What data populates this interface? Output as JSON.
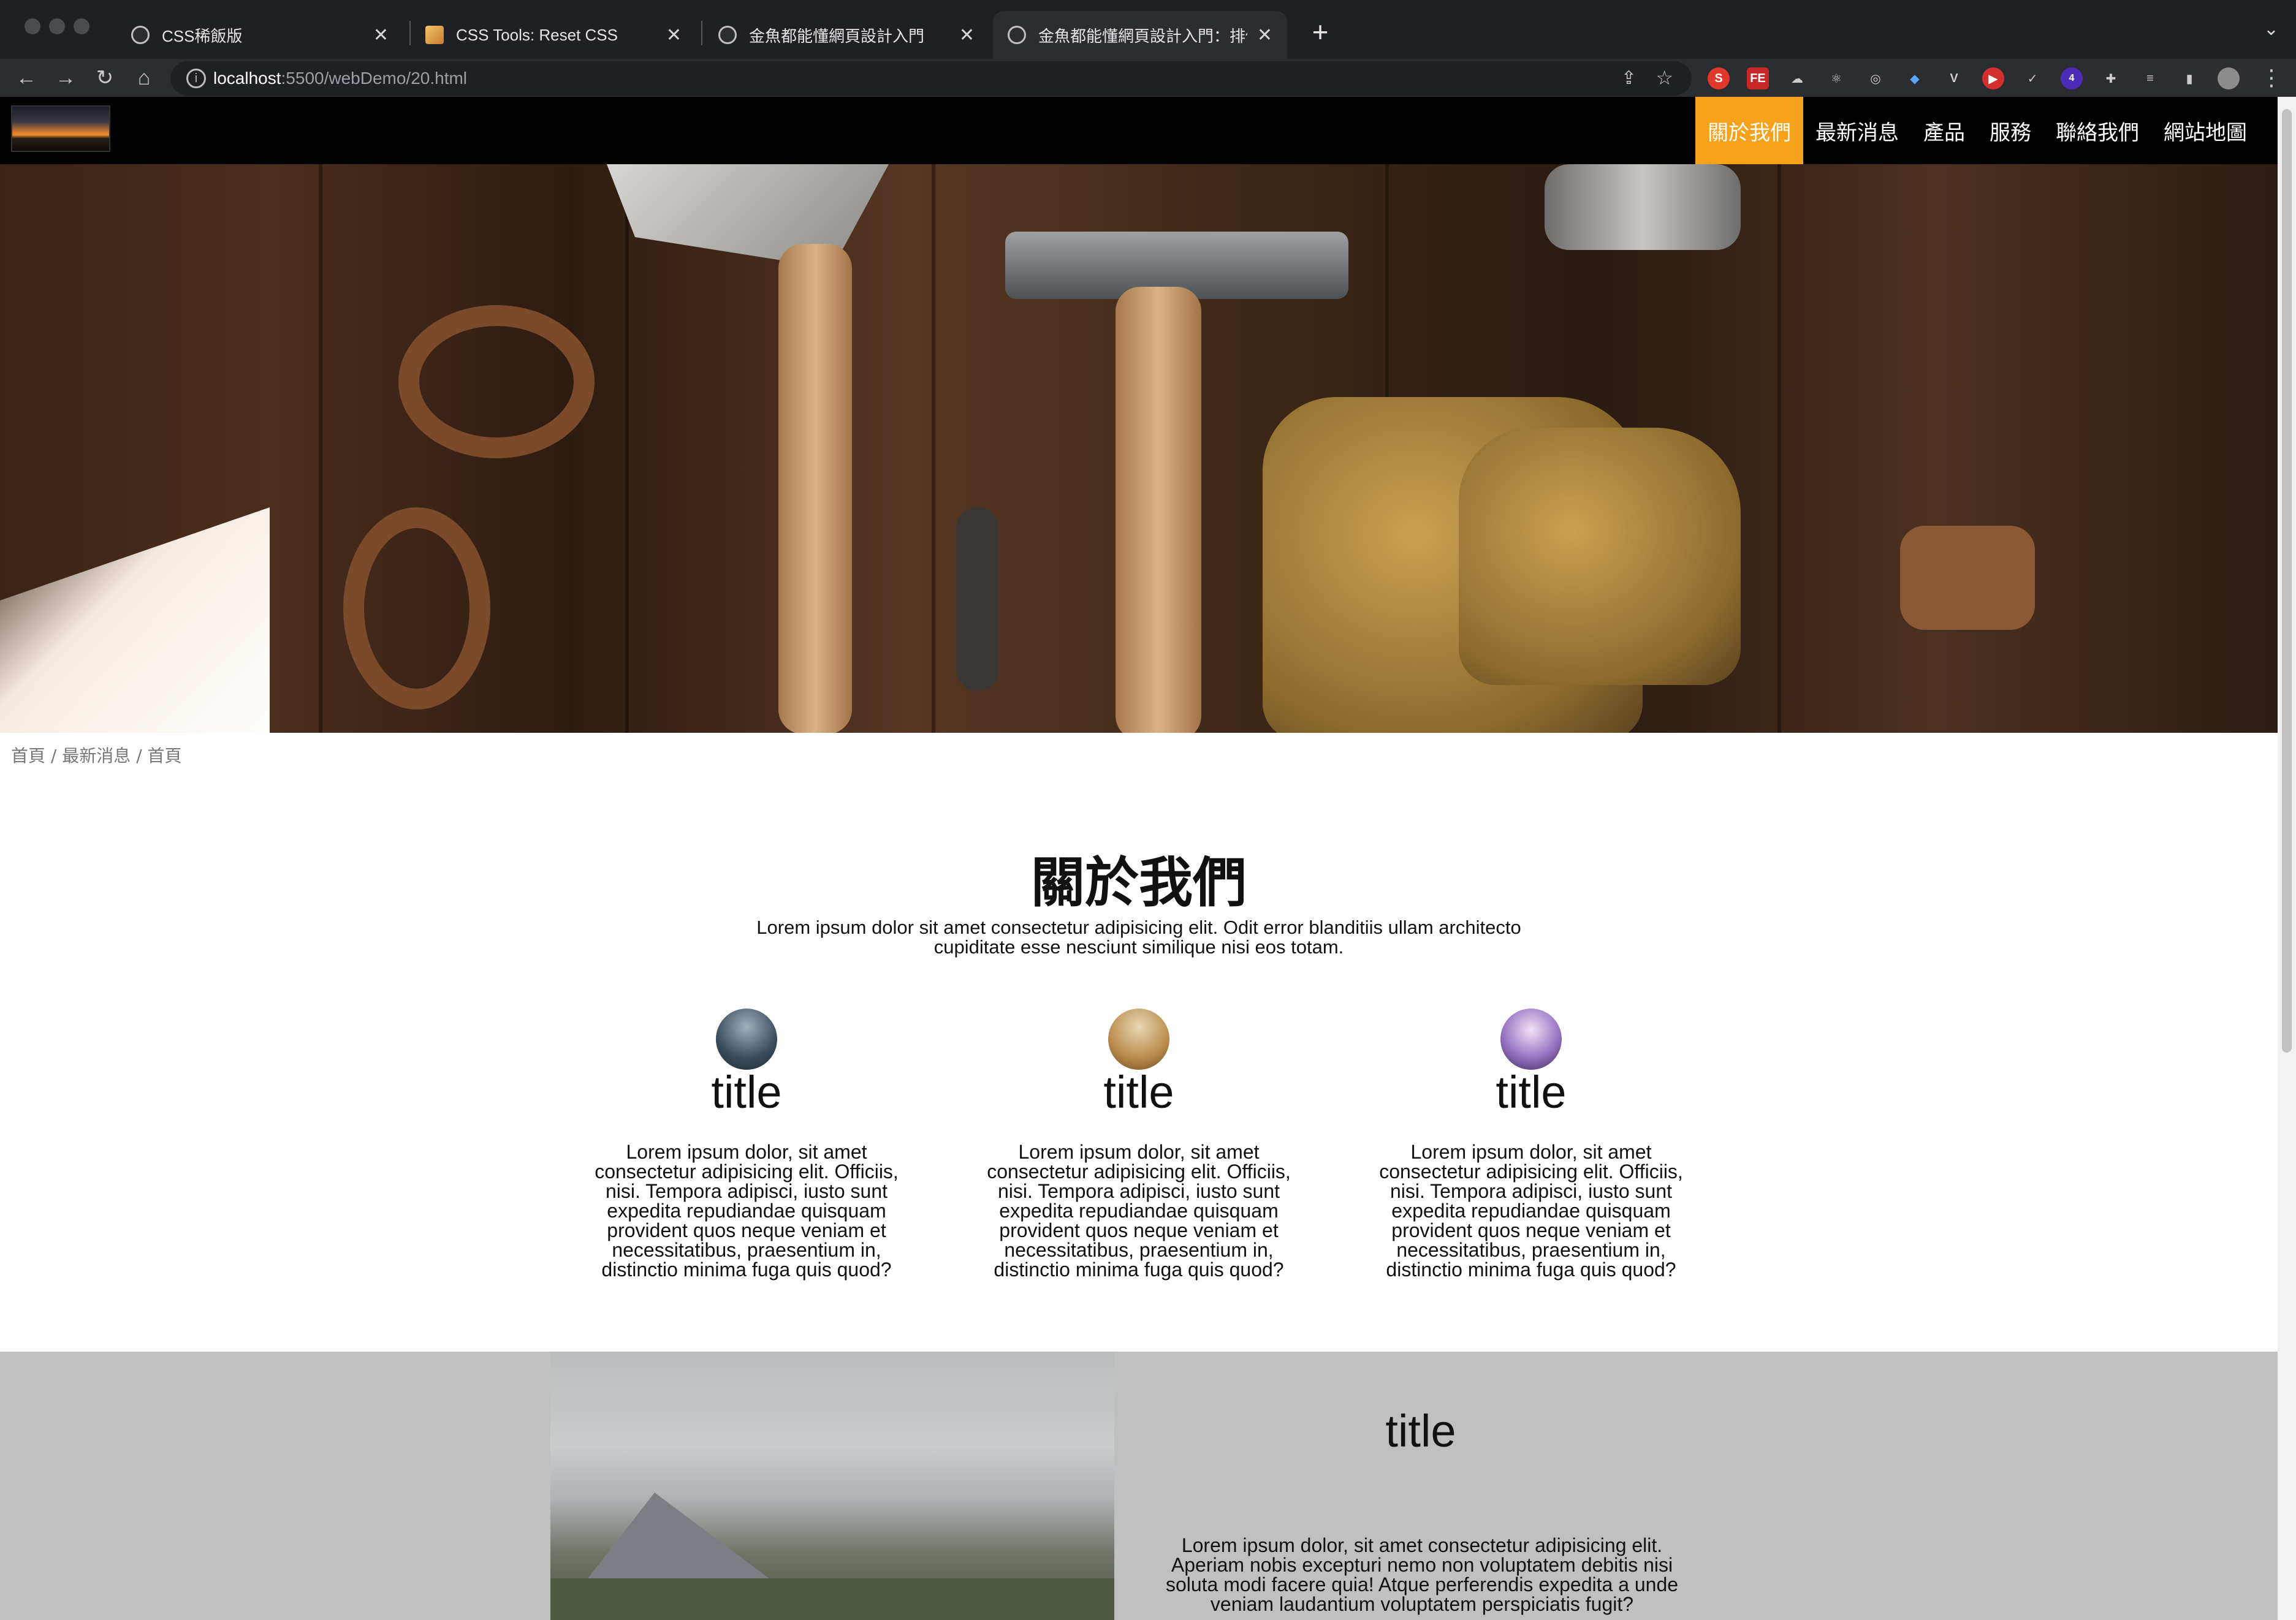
{
  "browser": {
    "tabs": [
      {
        "title": "CSS稀飯版"
      },
      {
        "title": "CSS Tools: Reset CSS"
      },
      {
        "title": "金魚都能懂網頁設計入門"
      },
      {
        "title": "金魚都能懂網頁設計入門：排個版"
      }
    ],
    "url_host": "localhost",
    "url_rest": ":5500/webDemo/20.html",
    "extension_badge": "4"
  },
  "site": {
    "menu": [
      "關於我們",
      "最新消息",
      "產品",
      "服務",
      "聯絡我們",
      "網站地圖"
    ],
    "active_menu": "關於我們",
    "accent_color": "#f7a21b",
    "breadcrumb": [
      "首頁",
      "最新消息",
      "首頁"
    ]
  },
  "about": {
    "title": "關於我們",
    "description": "Lorem ipsum dolor sit amet consectetur adipisicing elit. Odit error blanditiis ullam architecto cupiditate esse nesciunt similique nisi eos totam.",
    "cards": [
      {
        "title": "title",
        "text": "Lorem ipsum dolor, sit amet consectetur adipisicing elit. Officiis, nisi. Tempora adipisci, iusto sunt expedita repudiandae quisquam provident quos neque veniam et necessitatibus, praesentium in, distinctio minima fuga quis quod?"
      },
      {
        "title": "title",
        "text": "Lorem ipsum dolor, sit amet consectetur adipisicing elit. Officiis, nisi. Tempora adipisci, iusto sunt expedita repudiandae quisquam provident quos neque veniam et necessitatibus, praesentium in, distinctio minima fuga quis quod?"
      },
      {
        "title": "title",
        "text": "Lorem ipsum dolor, sit amet consectetur adipisicing elit. Officiis, nisi. Tempora adipisci, iusto sunt expedita repudiandae quisquam provident quos neque veniam et necessitatibus, praesentium in, distinctio minima fuga quis quod?"
      }
    ]
  },
  "feature": {
    "title": "title",
    "text": "Lorem ipsum dolor, sit amet consectetur adipisicing elit. Aperiam nobis excepturi nemo non voluptatem debitis nisi soluta modi facere quia! Atque perferendis expedita a unde veniam laudantium voluptatem perspiciatis fugit?"
  }
}
